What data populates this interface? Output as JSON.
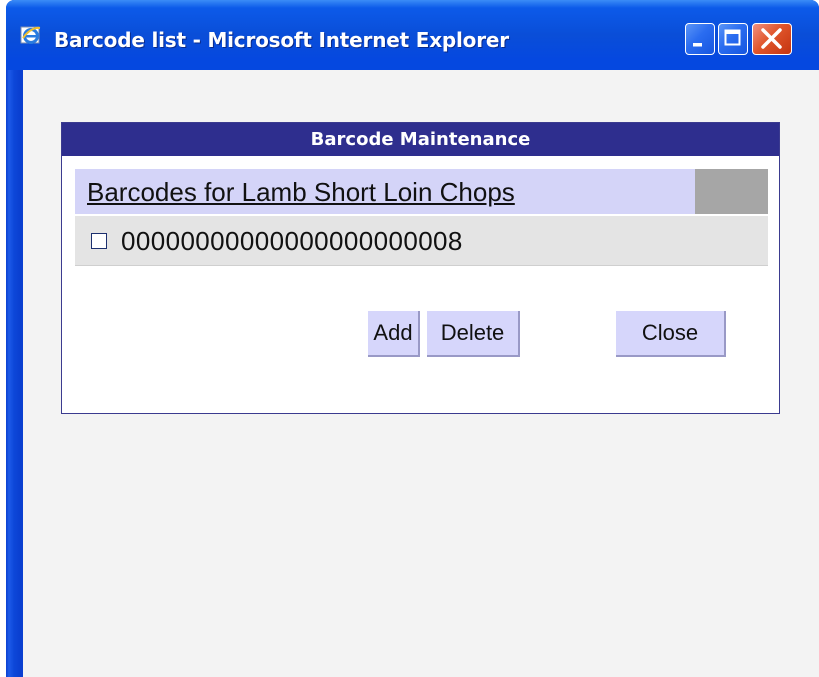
{
  "window": {
    "title": "Barcode list - Microsoft Internet Explorer"
  },
  "panel": {
    "header": "Barcode Maintenance",
    "list_header": "Barcodes for Lamb Short Loin Chops",
    "rows": [
      {
        "barcode": "00000000000000000000008",
        "checked": false
      }
    ]
  },
  "buttons": {
    "add_label": "Add",
    "delete_label": "Delete",
    "close_label": "Close"
  },
  "colors": {
    "panel_header": "#2e2e8e",
    "list_header_bg": "#d4d4f8",
    "button_bg": "#d6d6fb",
    "row_bg": "#e4e4e4",
    "client_bg": "#f3f3f3"
  },
  "icons": [
    "ie-icon",
    "minimize-icon",
    "maximize-icon",
    "close-icon"
  ]
}
